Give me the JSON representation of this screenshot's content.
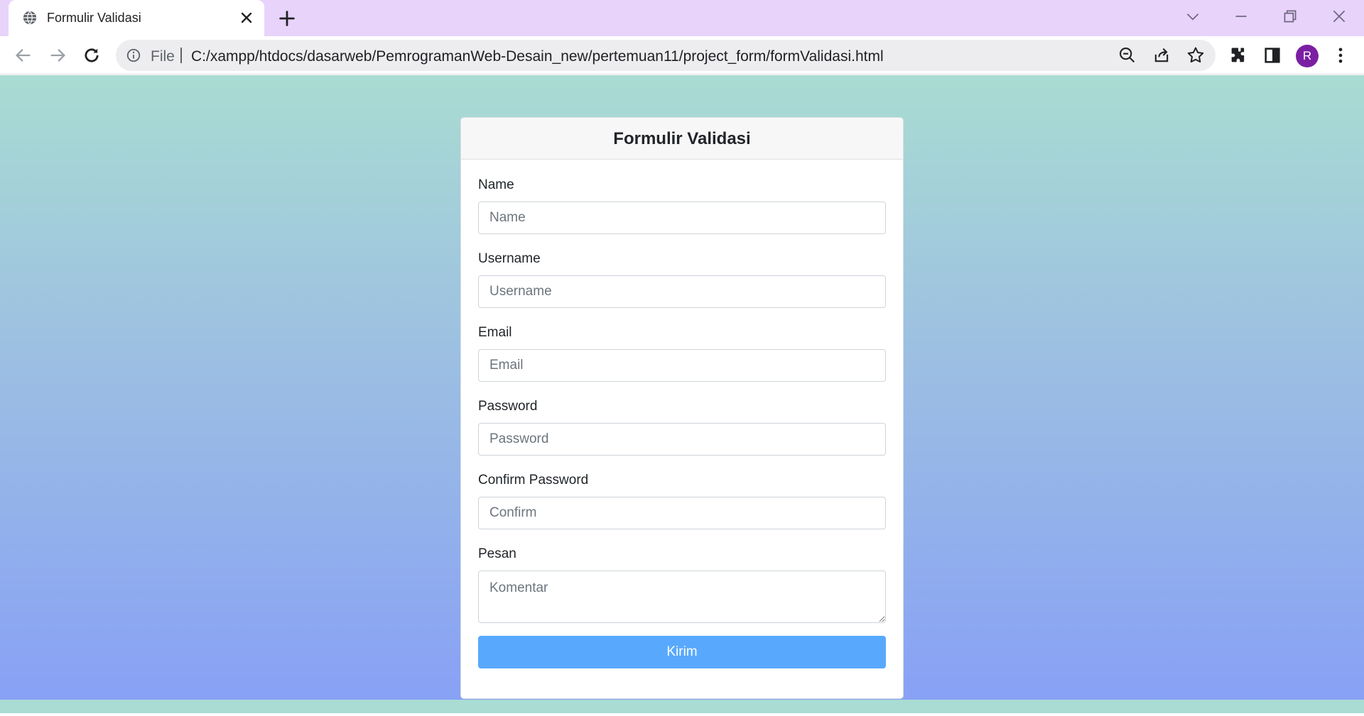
{
  "browser": {
    "tab_title": "Formulir Validasi",
    "new_tab_label": "+",
    "omnibox": {
      "scheme_label": "File",
      "url": "C:/xampp/htdocs/dasarweb/PemrogramanWeb-Desain_new/pertemuan11/project_form/formValidasi.html"
    },
    "profile_initial": "R",
    "colors": {
      "tabstrip": "#e8d3fb",
      "omnibox": "#ededf0",
      "avatar": "#7b1fa2"
    },
    "icons": [
      "globe-icon",
      "close-icon",
      "plus-icon",
      "chevron-down-icon",
      "minimize-icon",
      "restore-icon",
      "close-window-icon",
      "back-icon",
      "forward-icon",
      "reload-icon",
      "info-icon",
      "zoom-out-icon",
      "share-icon",
      "star-icon",
      "extensions-icon",
      "side-panel-icon",
      "more-icon"
    ]
  },
  "page": {
    "colors": {
      "gradient_top": "#a9dcd2",
      "gradient_bottom": "#88a1f5",
      "button": "#58a9fd"
    },
    "form": {
      "title": "Formulir Validasi",
      "fields": [
        {
          "label": "Name",
          "placeholder": "Name",
          "value": ""
        },
        {
          "label": "Username",
          "placeholder": "Username",
          "value": ""
        },
        {
          "label": "Email",
          "placeholder": "Email",
          "value": ""
        },
        {
          "label": "Password",
          "placeholder": "Password",
          "value": ""
        },
        {
          "label": "Confirm Password",
          "placeholder": "Confirm",
          "value": ""
        },
        {
          "label": "Pesan",
          "placeholder": "Komentar",
          "value": ""
        }
      ],
      "submit_label": "Kirim"
    }
  }
}
